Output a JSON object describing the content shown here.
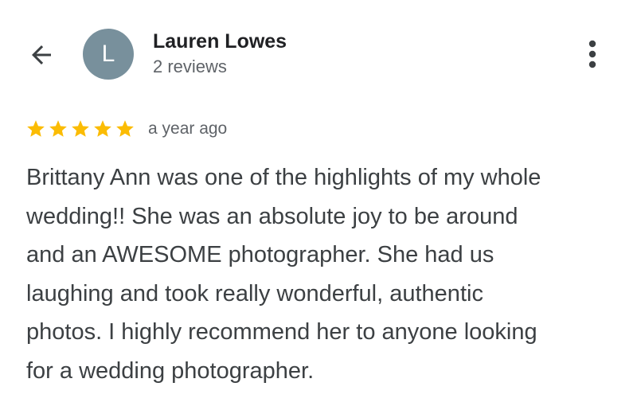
{
  "header": {
    "back_icon": "arrow-left-icon",
    "avatar_letter": "L",
    "avatar_color": "#78909c",
    "reviewer_name": "Lauren Lowes",
    "review_count": "2 reviews",
    "more_icon": "more-vert-icon"
  },
  "review": {
    "rating": 5,
    "rating_max": 5,
    "star_color": "#fbbc04",
    "time": "a year ago",
    "text_lines": [
      "Brittany Ann was one of the highlights of my whole",
      "wedding!! She was an absolute joy to be around",
      "and an AWESOME photographer. She had us",
      "laughing and took really wonderful, authentic",
      "photos. I highly recommend her to anyone looking",
      "for a wedding photographer."
    ]
  }
}
